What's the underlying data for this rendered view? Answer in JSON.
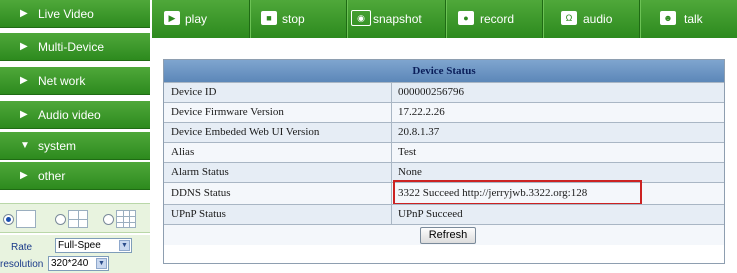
{
  "sidebar": {
    "items": [
      {
        "label": "Live Video",
        "icon": "right-triangle-icon"
      },
      {
        "label": "Multi-Device",
        "icon": "right-triangle-icon"
      },
      {
        "label": "Net work",
        "icon": "right-triangle-icon"
      },
      {
        "label": "Audio video",
        "icon": "right-triangle-icon"
      },
      {
        "label": "system",
        "icon": "down-triangle-icon"
      },
      {
        "label": "other",
        "icon": "right-triangle-icon"
      }
    ],
    "layout_options": [
      "single-view",
      "quad-view",
      "nine-view"
    ],
    "layout_selected": "single-view",
    "rate_label": "Rate",
    "rate_value": "Full-Spee",
    "resolution_label": "resolution",
    "resolution_value": "320*240"
  },
  "toolbar": {
    "buttons": [
      {
        "label": "play",
        "icon": "play-icon"
      },
      {
        "label": "stop",
        "icon": "stop-icon"
      },
      {
        "label": "snapshot",
        "icon": "camera-icon"
      },
      {
        "label": "record",
        "icon": "record-icon"
      },
      {
        "label": "audio",
        "icon": "headphones-icon"
      },
      {
        "label": "talk",
        "icon": "person-icon"
      }
    ]
  },
  "device_status": {
    "title": "Device Status",
    "rows": [
      {
        "name": "Device ID",
        "value": "000000256796"
      },
      {
        "name": "Device Firmware Version",
        "value": "17.22.2.26"
      },
      {
        "name": "Device Embeded Web UI Version",
        "value": "20.8.1.37"
      },
      {
        "name": "Alias",
        "value": "Test"
      },
      {
        "name": "Alarm Status",
        "value": "None"
      },
      {
        "name": "DDNS Status",
        "value": "3322 Succeed  http://jerryjwb.3322.org:128"
      },
      {
        "name": "UPnP Status",
        "value": "UPnP Succeed"
      }
    ],
    "refresh_label": "Refresh"
  },
  "colors": {
    "nav_green": "#2d8a1e",
    "header_blue": "#5c87b8",
    "highlight_red": "#cc2222"
  }
}
